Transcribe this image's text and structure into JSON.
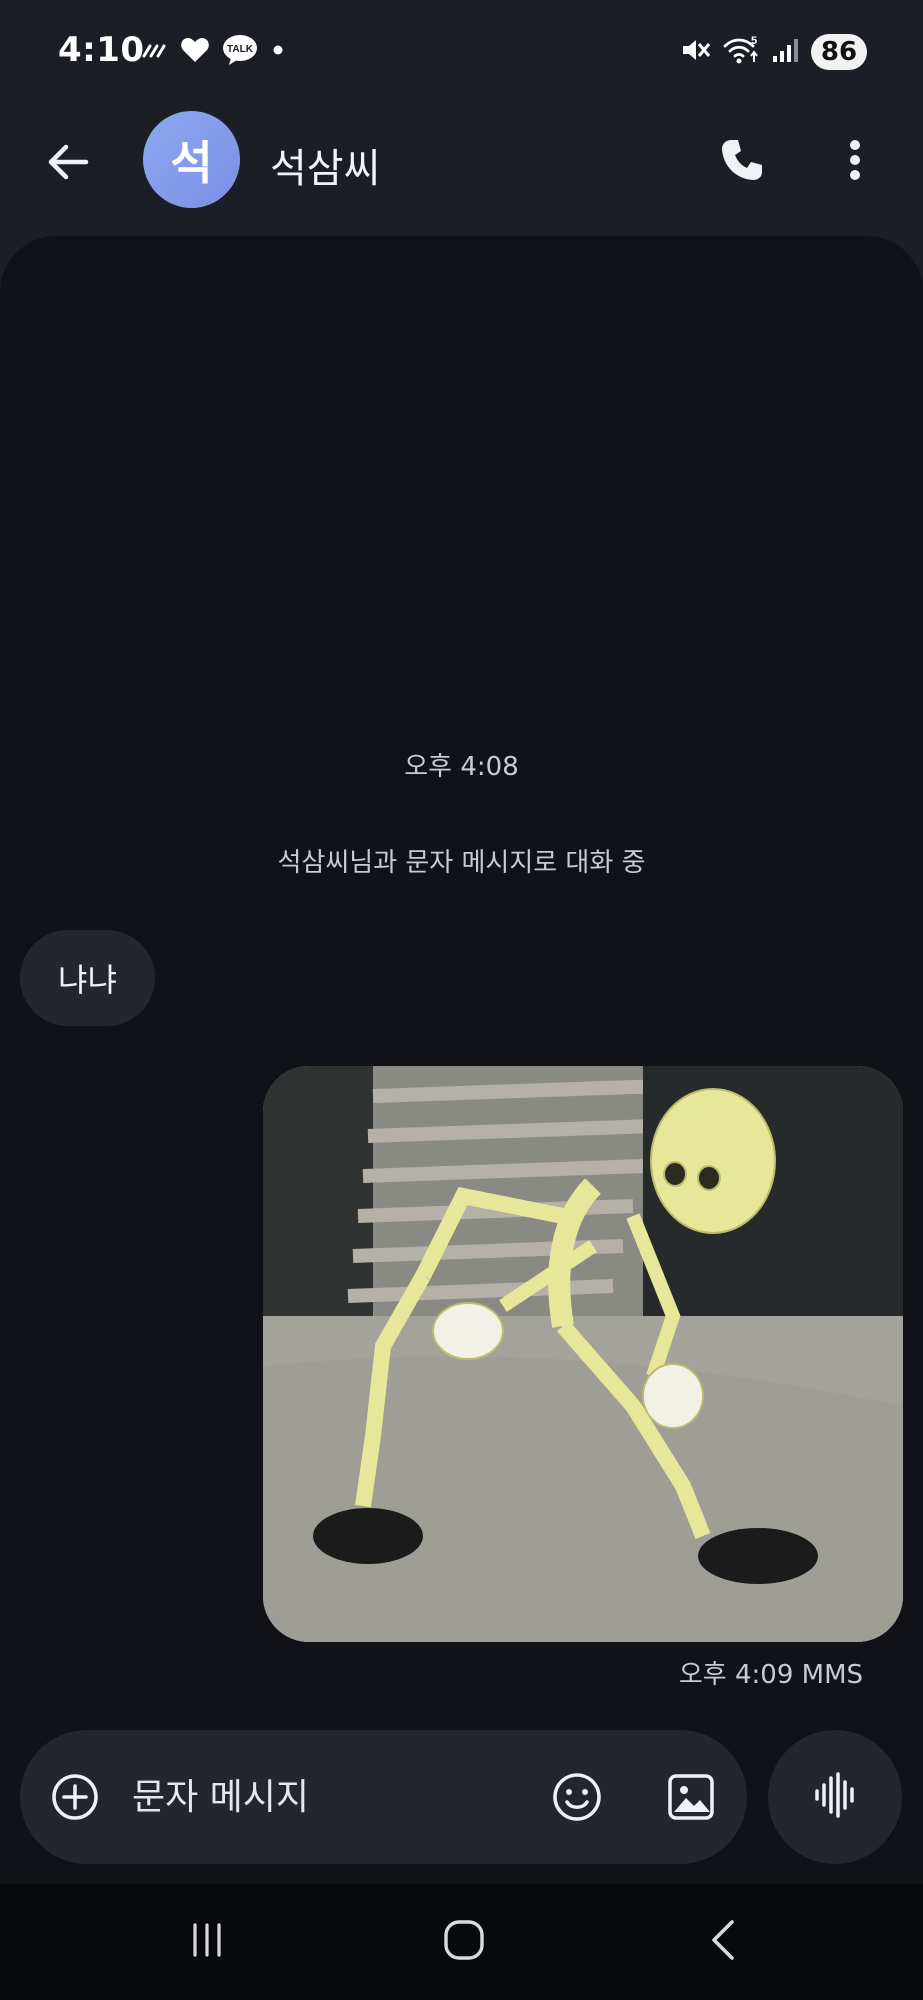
{
  "status_bar": {
    "time": "4:10",
    "left_icons": [
      "rain-icon",
      "heart-icon",
      "kakaotalk-icon",
      "dot-icon"
    ],
    "kakaotalk_label": "TALK",
    "right_icons": [
      "mute-icon",
      "wifi-icon",
      "signal-icon"
    ],
    "wifi_label": "5",
    "battery": "86"
  },
  "header": {
    "avatar_initial": "석",
    "avatar_color": "#8ea8f0",
    "contact_name": "석삼씨",
    "icons": [
      "back-arrow-icon",
      "phone-icon",
      "more-vert-icon"
    ]
  },
  "conversation": {
    "date_stamp": "오후 4:08",
    "system_notice": "석삼씨님과 문자 메시지로 대화 중",
    "messages": [
      {
        "direction": "incoming",
        "type": "text",
        "text": "냐냐"
      },
      {
        "direction": "outgoing",
        "type": "image",
        "meta": "오후 4:09 MMS"
      }
    ]
  },
  "composer": {
    "placeholder": "문자 메시지",
    "icons": [
      "add-circle-icon",
      "emoji-icon",
      "gallery-icon",
      "voice-wave-icon"
    ]
  },
  "nav_bar": {
    "buttons": [
      "recents-icon",
      "home-icon",
      "back-icon"
    ]
  },
  "colors": {
    "background": "#1c1e25",
    "conversation_bg": "#111218",
    "bubble_bg": "#24262d",
    "accent_avatar": "#8ea8f0"
  }
}
